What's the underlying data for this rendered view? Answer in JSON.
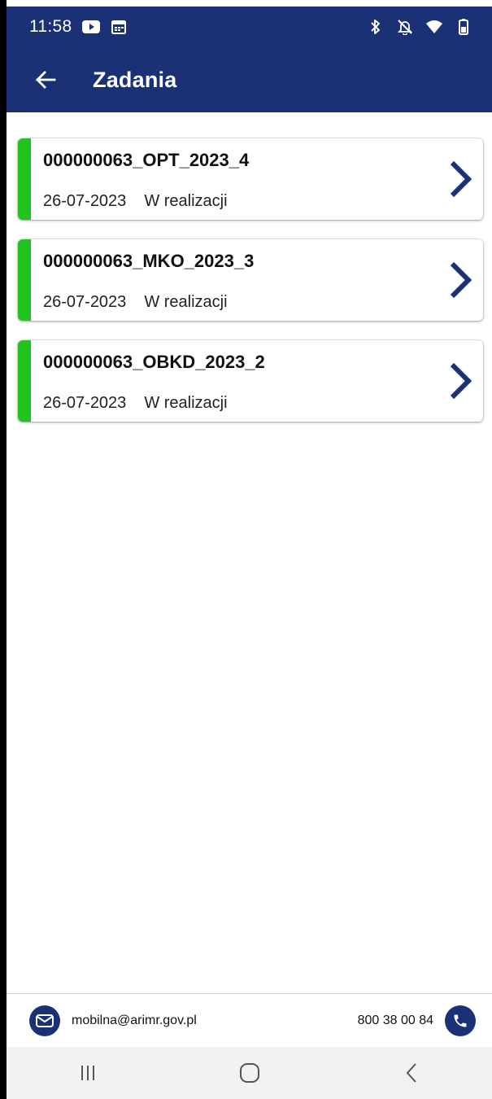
{
  "status_bar": {
    "time": "11:58",
    "left_icons": [
      "youtube-icon",
      "calendar-icon"
    ],
    "right_icons": [
      "bluetooth-icon",
      "notifications-off-icon",
      "wifi-icon",
      "battery-icon"
    ]
  },
  "app_bar": {
    "title": "Zadania",
    "back_icon": "arrow-left-icon"
  },
  "tasks": [
    {
      "id": "000000063_OPT_2023_4",
      "date": "26-07-2023",
      "status": "W realizacji",
      "accent": "#22c320"
    },
    {
      "id": "000000063_MKO_2023_3",
      "date": "26-07-2023",
      "status": "W realizacji",
      "accent": "#22c320"
    },
    {
      "id": "000000063_OBKD_2023_2",
      "date": "26-07-2023",
      "status": "W realizacji",
      "accent": "#22c320"
    }
  ],
  "footer": {
    "email": "mobilna@arimr.gov.pl",
    "phone": "800 38 00 84",
    "email_icon": "mail-icon",
    "phone_icon": "phone-icon"
  },
  "nav_bar": {
    "buttons": [
      "recent-apps-icon",
      "home-icon",
      "back-icon"
    ]
  },
  "colors": {
    "primary": "#1a3175",
    "status_accent": "#22c320"
  }
}
